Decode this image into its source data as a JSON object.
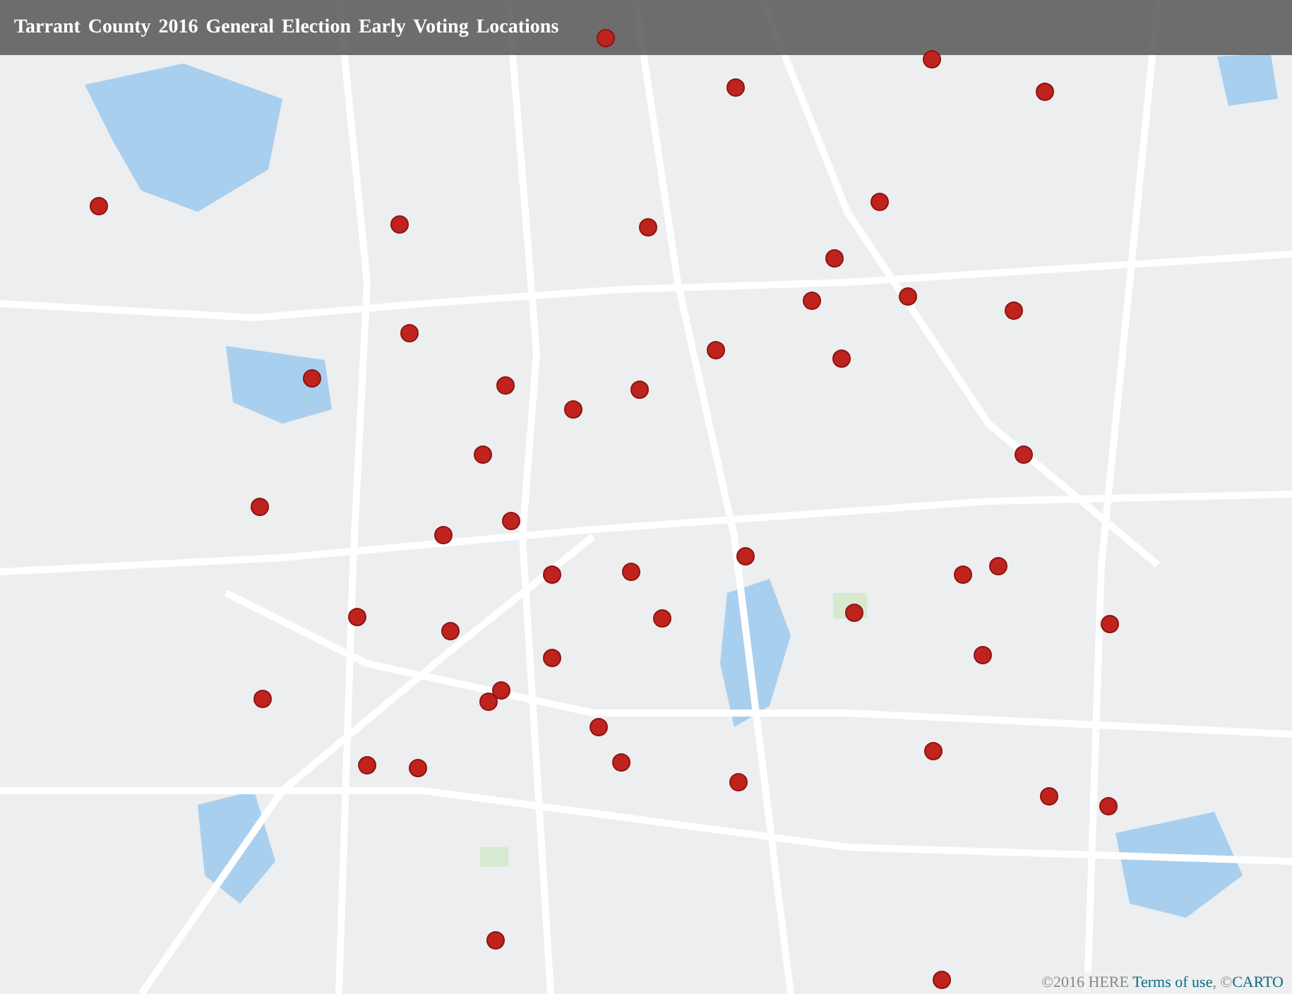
{
  "title": "Tarrant County 2016 General Election Early Voting Locations",
  "attribution": {
    "prefix": "©2016 HERE",
    "terms_link": "Terms of use",
    "separator": ", ©",
    "provider_link": "CARTO"
  }
}
